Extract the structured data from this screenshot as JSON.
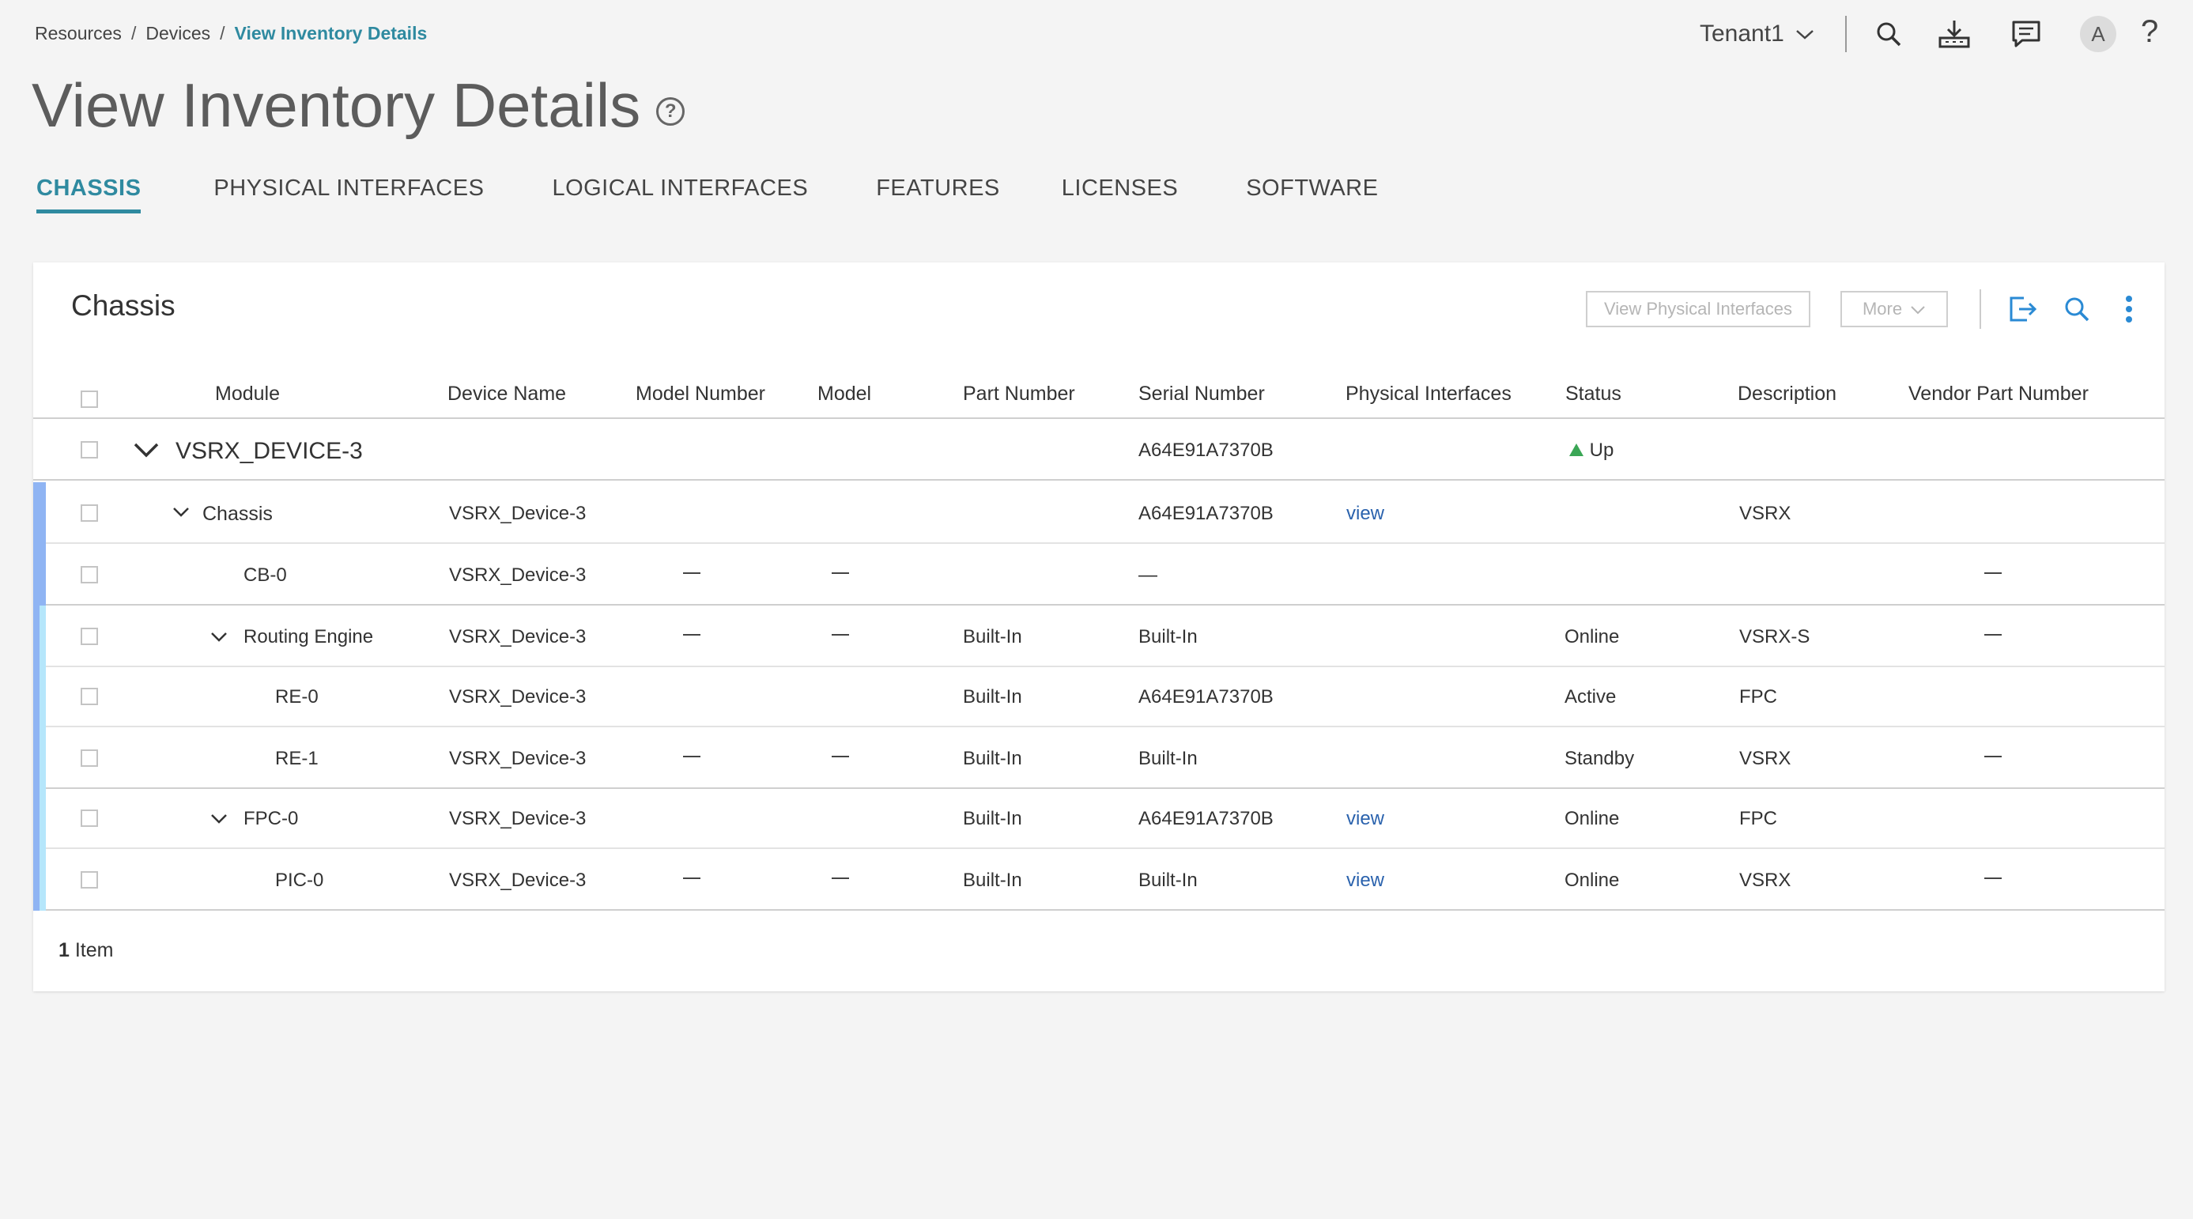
{
  "breadcrumb": {
    "items": [
      "Resources",
      "Devices"
    ],
    "current": "View Inventory Details",
    "sep": "/"
  },
  "header": {
    "tenant": "Tenant1",
    "avatar_letter": "A",
    "help_glyph": "?"
  },
  "page": {
    "title": "View Inventory Details",
    "title_help": "?"
  },
  "tabs": [
    "CHASSIS",
    "PHYSICAL INTERFACES",
    "LOGICAL INTERFACES",
    "FEATURES",
    "LICENSES",
    "SOFTWARE"
  ],
  "active_tab": "CHASSIS",
  "card": {
    "title": "Chassis",
    "view_physical_label": "View Physical Interfaces",
    "more_label": "More"
  },
  "columns": [
    "Module",
    "Device Name",
    "Model Number",
    "Model",
    "Part Number",
    "Serial Number",
    "Physical Interfaces",
    "Status",
    "Description",
    "Vendor Part Number"
  ],
  "dash": "—",
  "root_row": {
    "module": "VSRX_DEVICE-3",
    "serial": "A64E91A7370B",
    "status": "Up"
  },
  "rows": [
    {
      "module": "Chassis",
      "device": "VSRX_Device-3",
      "serial": "A64E91A7370B",
      "phys": "view",
      "description": "VSRX"
    },
    {
      "module": "CB-0",
      "device": "VSRX_Device-3",
      "serial": "—"
    },
    {
      "module": "Routing Engine",
      "device": "VSRX_Device-3",
      "part": "Built-In",
      "serial": "Built-In",
      "status": "Online",
      "description": "VSRX-S"
    },
    {
      "module": "RE-0",
      "device": "VSRX_Device-3",
      "part": "Built-In",
      "serial": "A64E91A7370B",
      "status": "Active",
      "description": "FPC"
    },
    {
      "module": "RE-1",
      "device": "VSRX_Device-3",
      "part": "Built-In",
      "serial": "Built-In",
      "status": "Standby",
      "description": "VSRX"
    },
    {
      "module": "FPC-0",
      "device": "VSRX_Device-3",
      "part": "Built-In",
      "serial": "A64E91A7370B",
      "phys": "view",
      "status": "Online",
      "description": "FPC"
    },
    {
      "module": "PIC-0",
      "device": "VSRX_Device-3",
      "part": "Built-In",
      "serial": "Built-In",
      "phys": "view",
      "status": "Online",
      "description": "VSRX"
    }
  ],
  "footer": {
    "count": "1",
    "label": "Item"
  },
  "colors": {
    "accent": "#2f8aa0",
    "link": "#2a62ad",
    "status_up": "#3aa655",
    "bar_level1": "#8fb4f3",
    "bar_level2": "#b5e6fb"
  }
}
